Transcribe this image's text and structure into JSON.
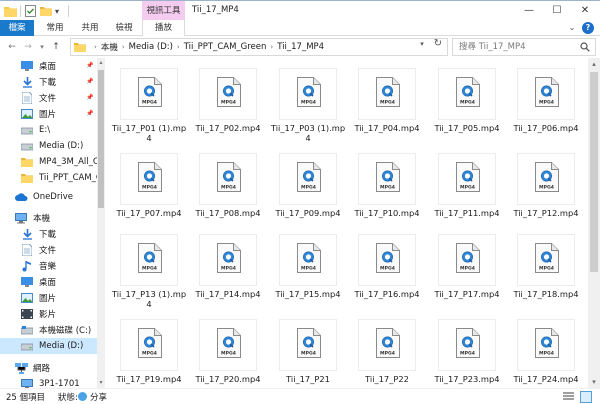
{
  "window": {
    "title": "Tii_17_MP4",
    "context_tab_header": "視訊工具",
    "controls": {
      "minimize": "—",
      "maximize": "☐",
      "close": "✕"
    }
  },
  "ribbon": {
    "tabs": [
      "檔案",
      "常用",
      "共用",
      "檢視",
      "播放"
    ],
    "help": "?"
  },
  "address": {
    "crumbs": [
      "本機",
      "Media (D:)",
      "Tii_PPT_CAM_Green",
      "Tii_17_MP4"
    ],
    "separator": "›"
  },
  "search": {
    "placeholder": "搜尋 Tii_17_MP4"
  },
  "sidebar": {
    "items": [
      {
        "label": "桌面",
        "icon": "desktop-icon",
        "pinned": true
      },
      {
        "label": "下載",
        "icon": "download-icon",
        "pinned": true
      },
      {
        "label": "文件",
        "icon": "documents-icon",
        "pinned": true
      },
      {
        "label": "圖片",
        "icon": "pictures-icon",
        "pinned": true
      },
      {
        "label": "E:\\",
        "icon": "drive-icon",
        "pinned": false
      },
      {
        "label": "Media (D:)",
        "icon": "drive-icon",
        "pinned": false
      },
      {
        "label": "MP4_3M_All_Clip",
        "icon": "folder-icon",
        "pinned": false
      },
      {
        "label": "Tii_PPT_CAM_Gre",
        "icon": "folder-icon",
        "pinned": false
      },
      {
        "label": "OneDrive",
        "icon": "onedrive-icon",
        "pinned": false
      },
      {
        "label": "本機",
        "icon": "computer-icon",
        "pinned": false
      },
      {
        "label": "下載",
        "icon": "download-icon",
        "pinned": false
      },
      {
        "label": "文件",
        "icon": "documents-icon",
        "pinned": false
      },
      {
        "label": "音樂",
        "icon": "music-icon",
        "pinned": false
      },
      {
        "label": "桌面",
        "icon": "desktop-icon",
        "pinned": false
      },
      {
        "label": "圖片",
        "icon": "pictures-icon",
        "pinned": false
      },
      {
        "label": "影片",
        "icon": "videos-icon",
        "pinned": false
      },
      {
        "label": "本機磁碟 (C:)",
        "icon": "drive-c-icon",
        "pinned": false
      },
      {
        "label": "Media (D:)",
        "icon": "drive-icon",
        "pinned": false,
        "selected": true
      },
      {
        "label": "網路",
        "icon": "network-icon",
        "pinned": false
      },
      {
        "label": "3P1-1701",
        "icon": "computer-icon",
        "pinned": false
      }
    ]
  },
  "files": [
    {
      "name": "Tii_17_P01 (1).mp4",
      "badge": "MPG4"
    },
    {
      "name": "Tii_17_P02.mp4",
      "badge": "MPG4"
    },
    {
      "name": "Tii_17_P03 (1).mp4",
      "badge": "MPG4"
    },
    {
      "name": "Tii_17_P04.mp4",
      "badge": "MPG4"
    },
    {
      "name": "Tii_17_P05.mp4",
      "badge": "MPG4"
    },
    {
      "name": "Tii_17_P06.mp4",
      "badge": "MPG4"
    },
    {
      "name": "Tii_17_P07.mp4",
      "badge": "MPG4"
    },
    {
      "name": "Tii_17_P08.mp4",
      "badge": "MPG4"
    },
    {
      "name": "Tii_17_P09.mp4",
      "badge": "MPG4"
    },
    {
      "name": "Tii_17_P10.mp4",
      "badge": "MPG4"
    },
    {
      "name": "Tii_17_P11.mp4",
      "badge": "MPG4"
    },
    {
      "name": "Tii_17_P12.mp4",
      "badge": "MPG4"
    },
    {
      "name": "Tii_17_P13 (1).mp4",
      "badge": "MPG4"
    },
    {
      "name": "Tii_17_P14.mp4",
      "badge": "MPG4"
    },
    {
      "name": "Tii_17_P15.mp4",
      "badge": "MPG4"
    },
    {
      "name": "Tii_17_P16.mp4",
      "badge": "MPG4"
    },
    {
      "name": "Tii_17_P17.mp4",
      "badge": "MPG4"
    },
    {
      "name": "Tii_17_P18.mp4",
      "badge": "MPG4"
    },
    {
      "name": "Tii_17_P19.mp4",
      "badge": "MPG4"
    },
    {
      "name": "Tii_17_P20.mp4",
      "badge": "MPG4"
    },
    {
      "name": "Tii_17_P21",
      "badge": "MPG4"
    },
    {
      "name": "Tii_17_P22",
      "badge": "MPG4"
    },
    {
      "name": "Tii_17_P23.mp4",
      "badge": "MPG4"
    },
    {
      "name": "Tii_17_P24.mp4",
      "badge": "MPG4"
    }
  ],
  "status": {
    "count": "25 個項目",
    "state": "狀態:",
    "share": "分享"
  },
  "colors": {
    "accent": "#1979ca",
    "context_tab": "#f4ccf0",
    "selection": "#cce8ff",
    "folder": "#f5c94a"
  }
}
